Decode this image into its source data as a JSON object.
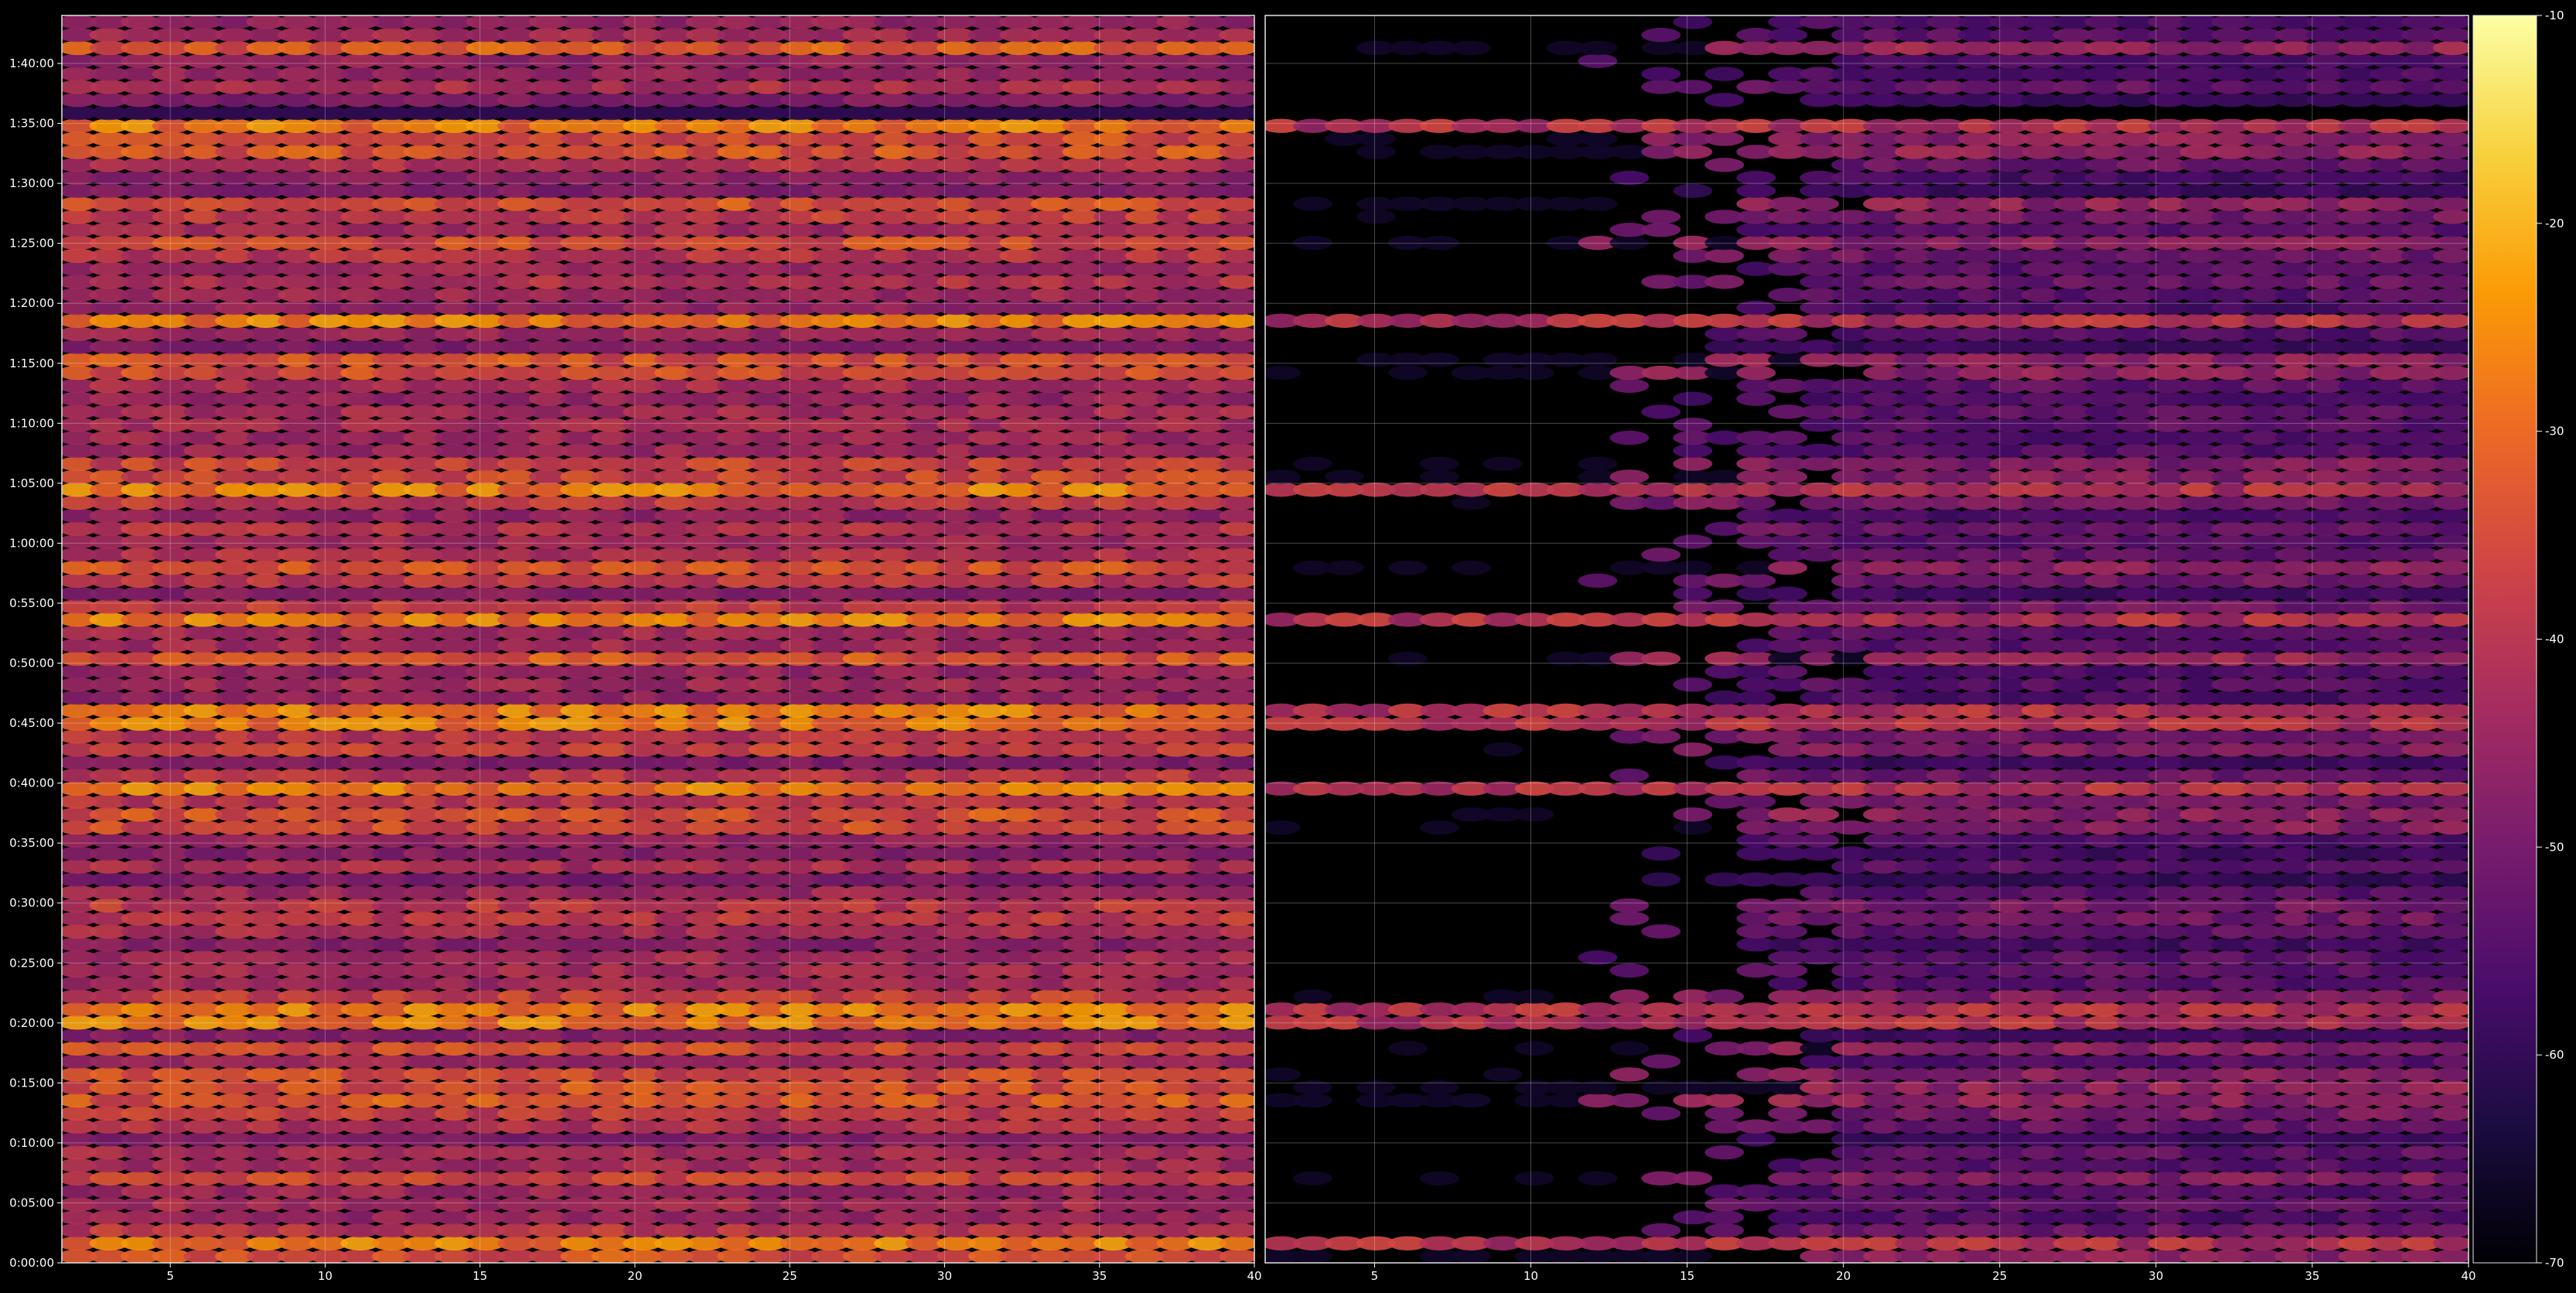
{
  "chart_data": {
    "type": "heatmap",
    "background": "#000000",
    "colormap": "inferno",
    "colormap_stops": [
      "#000004",
      "#1b0c41",
      "#4a0c6b",
      "#781c6d",
      "#a52c60",
      "#cf4446",
      "#ed6925",
      "#fb9b06",
      "#f7d13d",
      "#fcffa4"
    ],
    "grid": true,
    "panels": [
      {
        "id": "left",
        "x": {
          "range": [
            1.5,
            40
          ],
          "ticks": [
            5,
            10,
            15,
            20,
            25,
            30,
            35,
            40
          ],
          "tick_labels": [
            "5",
            "10",
            "15",
            "20",
            "25",
            "30",
            "35",
            "40"
          ]
        },
        "y": {
          "range_seconds": [
            0,
            6240
          ],
          "ticks": [
            "0:00:00",
            "0:05:00",
            "0:10:00",
            "0:15:00",
            "0:20:00",
            "0:25:00",
            "0:30:00",
            "0:35:00",
            "0:40:00",
            "0:45:00",
            "0:50:00",
            "0:55:00",
            "1:00:00",
            "1:05:00",
            "1:10:00",
            "1:15:00",
            "1:20:00",
            "1:25:00",
            "1:30:00",
            "1:35:00",
            "1:40:00"
          ]
        },
        "value_band_dB": [
          -62,
          -22
        ]
      },
      {
        "id": "right",
        "x": {
          "range": [
            1.5,
            40
          ],
          "ticks": [
            5,
            10,
            15,
            20,
            25,
            30,
            35,
            40
          ],
          "tick_labels": [
            "5",
            "10",
            "15",
            "20",
            "25",
            "30",
            "35",
            "40"
          ]
        },
        "y": {
          "range_seconds": [
            0,
            6240
          ]
        },
        "value_band_dB": [
          -70,
          -36
        ]
      }
    ],
    "colorbar": {
      "range": [
        -70,
        -10
      ],
      "ticks": [
        -70,
        -60,
        -50,
        -40,
        -30,
        -20,
        -10
      ],
      "tick_labels": [
        "-70",
        "-60",
        "-50",
        "-40",
        "-30",
        "-20",
        "-10"
      ]
    },
    "notable_rows_time": [
      "1:35:00",
      "1:18:30",
      "1:04:30",
      "0:54:00",
      "0:45:30",
      "0:39:30",
      "0:20:30",
      "0:02:00"
    ]
  }
}
